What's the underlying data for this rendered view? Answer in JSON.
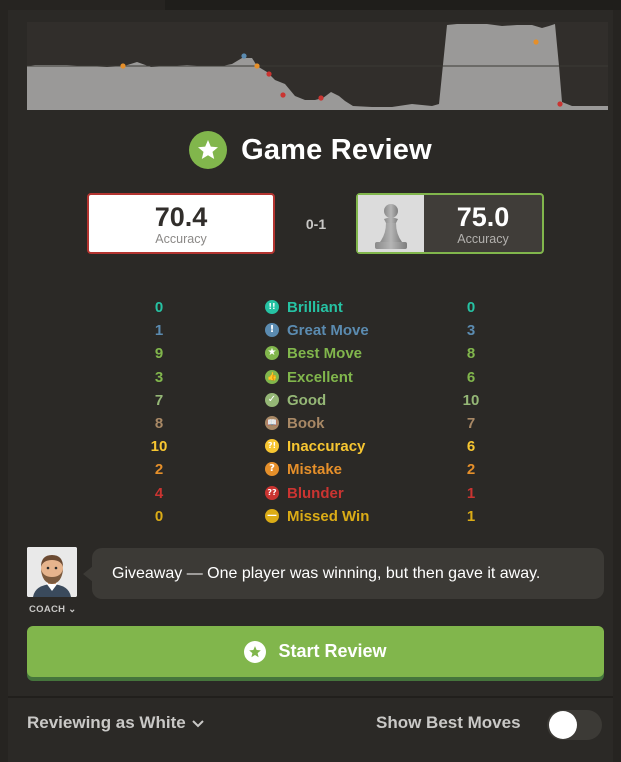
{
  "title": "Game Review",
  "players": {
    "white": {
      "accuracy": "70.4",
      "label": "Accuracy"
    },
    "black": {
      "accuracy": "75.0",
      "label": "Accuracy"
    }
  },
  "result": "0-1",
  "stats": [
    {
      "name": "Brilliant",
      "white": "0",
      "black": "0",
      "color": "#26c2a3",
      "glyph": "!!"
    },
    {
      "name": "Great Move",
      "white": "1",
      "black": "3",
      "color": "#5b8bb0",
      "glyph": "!"
    },
    {
      "name": "Best Move",
      "white": "9",
      "black": "8",
      "color": "#81b64c",
      "glyph": "★"
    },
    {
      "name": "Excellent",
      "white": "3",
      "black": "6",
      "color": "#81b64c",
      "glyph": "👍"
    },
    {
      "name": "Good",
      "white": "7",
      "black": "10",
      "color": "#95b776",
      "glyph": "✓"
    },
    {
      "name": "Book",
      "white": "8",
      "black": "7",
      "color": "#a88865",
      "glyph": "📖"
    },
    {
      "name": "Inaccuracy",
      "white": "10",
      "black": "6",
      "color": "#f7c631",
      "glyph": "?!"
    },
    {
      "name": "Mistake",
      "white": "2",
      "black": "2",
      "color": "#e58f2a",
      "glyph": "?"
    },
    {
      "name": "Blunder",
      "white": "4",
      "black": "1",
      "color": "#ca3431",
      "glyph": "??"
    },
    {
      "name": "Missed Win",
      "white": "0",
      "black": "1",
      "color": "#dbac16",
      "glyph": "—"
    }
  ],
  "coach": {
    "label": "COACH",
    "message": "Giveaway — One player was winning, but then gave it away."
  },
  "start_button": "Start Review",
  "reviewing_as": "Reviewing as White",
  "show_best_moves": "Show Best Moves",
  "show_best_moves_on": false
}
